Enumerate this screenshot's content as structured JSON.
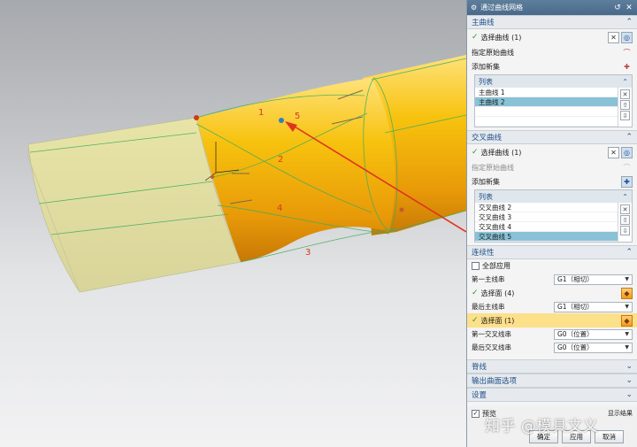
{
  "viewport": {
    "curve_labels": [
      "1",
      "5",
      "2",
      "4",
      "3"
    ]
  },
  "dialog": {
    "title": "通过曲线网格",
    "primary": {
      "header": "主曲线",
      "select_curve": "选择曲线 (1)",
      "specify_origin": "指定原始曲线",
      "add_set": "添加新集",
      "list_header": "列表",
      "items": [
        "主曲线 1",
        "主曲线 2"
      ],
      "selected_index": 1
    },
    "cross": {
      "header": "交叉曲线",
      "select_curve": "选择曲线 (1)",
      "specify_origin": "指定原始曲线",
      "add_set": "添加新集",
      "list_header": "列表",
      "items": [
        "交叉曲线 2",
        "交叉曲线 3",
        "交叉曲线 4",
        "交叉曲线 5"
      ],
      "selected_index": 3
    },
    "continuity": {
      "header": "连续性",
      "apply_all": "全部应用",
      "first_primary": "第一主线串",
      "first_primary_value": "G1（相切）",
      "select_face_1": "选择面 (4)",
      "last_primary": "最后主线串",
      "last_primary_value": "G1（相切）",
      "select_face_2": "选择面 (1)",
      "first_cross": "第一交叉线串",
      "first_cross_value": "G0（位置）",
      "last_cross": "最后交叉线串",
      "last_cross_value": "G0（位置）"
    },
    "collapsed_sections": [
      "脊线",
      "输出曲面选项",
      "设置"
    ],
    "preview_label": "预览",
    "show_result_label": "显示结果",
    "buttons": [
      "确定",
      "应用",
      "取消"
    ],
    "watermark": "知乎 @模具文义"
  },
  "colors": {
    "surface": "#f7c20e",
    "accent": "#1f4f86",
    "selected_row": "#89c2d6",
    "highlight_row": "#fde08a"
  }
}
